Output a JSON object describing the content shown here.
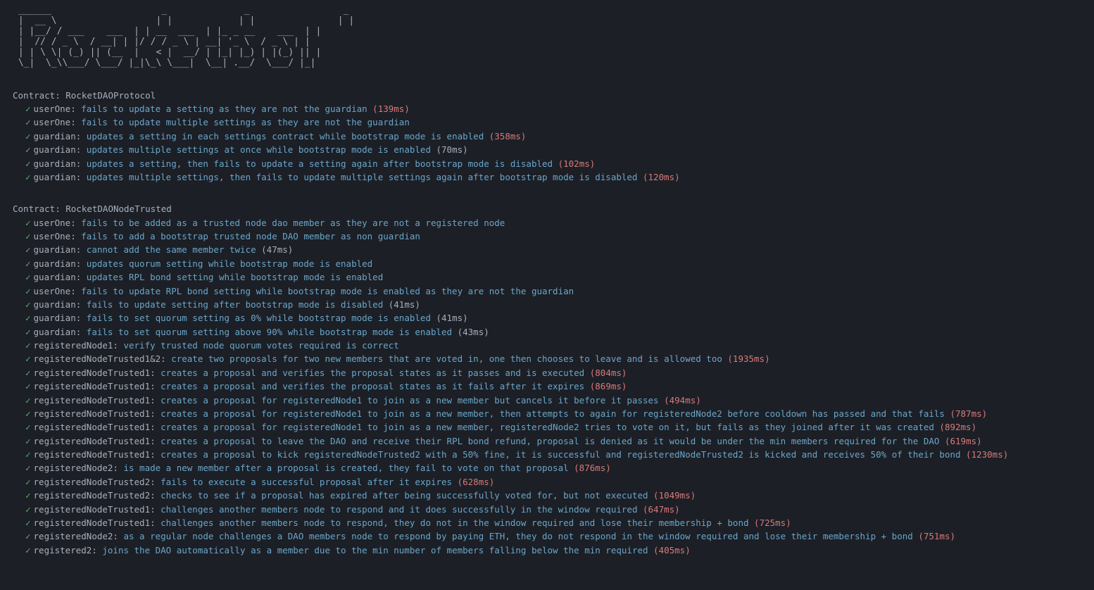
{
  "ascii_art": " ______                    _              _                 _\n |  __ \\                  | |            | |               | |\n | |__/ / ___    ___  | | __  ___  | |_ _ __    ___  | |\n |  // / _ \\  / __| | |/ / / _ \\ | __| '_ \\  / _ \\ | |\n | | \\ \\| (_) || (__  |   < |  __/ | |_| |_) | |(_) || |\n \\_|  \\_\\\\___/ \\___/ |_|\\_\\ \\___|  \\__| .__/  \\___/ |_|",
  "contracts": [
    {
      "name": "Contract: RocketDAOProtocol",
      "tests": [
        {
          "actor": "userOne:",
          "desc": "fails to update a setting as they are not the guardian",
          "timing": "(139ms)",
          "timing_style": "red"
        },
        {
          "actor": "userOne:",
          "desc": "fails to update multiple settings as they are not the guardian",
          "timing": "",
          "timing_style": ""
        },
        {
          "actor": "guardian:",
          "desc": "updates a setting in each settings contract while bootstrap mode is enabled",
          "timing": "(358ms)",
          "timing_style": "red"
        },
        {
          "actor": "guardian:",
          "desc": "updates multiple settings at once while bootstrap mode is enabled",
          "timing": "(70ms)",
          "timing_style": "normal"
        },
        {
          "actor": "guardian:",
          "desc": "updates a setting, then fails to update a setting again after bootstrap mode is disabled",
          "timing": "(102ms)",
          "timing_style": "red"
        },
        {
          "actor": "guardian:",
          "desc": "updates multiple settings, then fails to update multiple settings again after bootstrap mode is disabled",
          "timing": "(120ms)",
          "timing_style": "red"
        }
      ]
    },
    {
      "name": "Contract: RocketDAONodeTrusted",
      "tests": [
        {
          "actor": "userOne:",
          "desc": "fails to be added as a trusted node dao member as they are not a registered node",
          "timing": "",
          "timing_style": ""
        },
        {
          "actor": "userOne:",
          "desc": "fails to add a bootstrap trusted node DAO member as non guardian",
          "timing": "",
          "timing_style": ""
        },
        {
          "actor": "guardian:",
          "desc": "cannot add the same member twice",
          "timing": "(47ms)",
          "timing_style": "normal"
        },
        {
          "actor": "guardian:",
          "desc": "updates quorum setting while bootstrap mode is enabled",
          "timing": "",
          "timing_style": ""
        },
        {
          "actor": "guardian:",
          "desc": "updates RPL bond setting while bootstrap mode is enabled",
          "timing": "",
          "timing_style": ""
        },
        {
          "actor": "userOne:",
          "desc": "fails to update RPL bond setting while bootstrap mode is enabled as they are not the guardian",
          "timing": "",
          "timing_style": ""
        },
        {
          "actor": "guardian:",
          "desc": "fails to update setting after bootstrap mode is disabled",
          "timing": "(41ms)",
          "timing_style": "normal"
        },
        {
          "actor": "guardian:",
          "desc": "fails to set quorum setting as 0% while bootstrap mode is enabled",
          "timing": "(41ms)",
          "timing_style": "normal"
        },
        {
          "actor": "guardian:",
          "desc": "fails to set quorum setting above 90% while bootstrap mode is enabled",
          "timing": "(43ms)",
          "timing_style": "normal"
        },
        {
          "actor": "registeredNode1:",
          "desc": "verify trusted node quorum votes required is correct",
          "timing": "",
          "timing_style": ""
        },
        {
          "actor": "registeredNodeTrusted1&2:",
          "desc": "create two proposals for two new members that are voted in, one then chooses to leave and is allowed too",
          "timing": "(1935ms)",
          "timing_style": "red"
        },
        {
          "actor": "registeredNodeTrusted1:",
          "desc": "creates a proposal and verifies the proposal states as it passes and is executed",
          "timing": "(804ms)",
          "timing_style": "red"
        },
        {
          "actor": "registeredNodeTrusted1:",
          "desc": "creates a proposal and verifies the proposal states as it fails after it expires",
          "timing": "(869ms)",
          "timing_style": "red"
        },
        {
          "actor": "registeredNodeTrusted1:",
          "desc": "creates a proposal for registeredNode1 to join as a new member but cancels it before it passes",
          "timing": "(494ms)",
          "timing_style": "red"
        },
        {
          "actor": "registeredNodeTrusted1:",
          "desc": "creates a proposal for registeredNode1 to join as a new member, then attempts to again for registeredNode2 before cooldown has passed and that fails",
          "timing": "(787ms)",
          "timing_style": "red"
        },
        {
          "actor": "registeredNodeTrusted1:",
          "desc": "creates a proposal for registeredNode1 to join as a new member, registeredNode2 tries to vote on it, but fails as they joined after it was created",
          "timing": "(892ms)",
          "timing_style": "red"
        },
        {
          "actor": "registeredNodeTrusted1:",
          "desc": "creates a proposal to leave the DAO and receive their RPL bond refund, proposal is denied as it would be under the min members required for the DAO",
          "timing": "(619ms)",
          "timing_style": "red"
        },
        {
          "actor": "registeredNodeTrusted1:",
          "desc": "creates a proposal to kick registeredNodeTrusted2 with a 50% fine, it is successful and registeredNodeTrusted2 is kicked and receives 50% of their bond",
          "timing": "(1230ms)",
          "timing_style": "red"
        },
        {
          "actor": "registeredNode2:",
          "desc": "is made a new member after a proposal is created, they fail to vote on that proposal",
          "timing": "(876ms)",
          "timing_style": "red"
        },
        {
          "actor": "registeredNodeTrusted2:",
          "desc": "fails to execute a successful proposal after it expires",
          "timing": "(628ms)",
          "timing_style": "red"
        },
        {
          "actor": "registeredNodeTrusted2:",
          "desc": "checks to see if a proposal has expired after being successfully voted for, but not executed",
          "timing": "(1049ms)",
          "timing_style": "red"
        },
        {
          "actor": "registeredNodeTrusted1:",
          "desc": "challenges another members node to respond and it does successfully in the window required",
          "timing": "(647ms)",
          "timing_style": "red"
        },
        {
          "actor": "registeredNodeTrusted1:",
          "desc": "challenges another members node to respond, they do not in the window required and lose their membership + bond",
          "timing": "(725ms)",
          "timing_style": "red"
        },
        {
          "actor": "registeredNode2:",
          "desc": "as a regular node challenges a DAO members node to respond by paying ETH, they do not respond in the window required and lose their membership + bond",
          "timing": "(751ms)",
          "timing_style": "red"
        },
        {
          "actor": "registered2:",
          "desc": "joins the DAO automatically as a member due to the min number of members falling below the min required",
          "timing": "(405ms)",
          "timing_style": "red"
        }
      ]
    }
  ]
}
